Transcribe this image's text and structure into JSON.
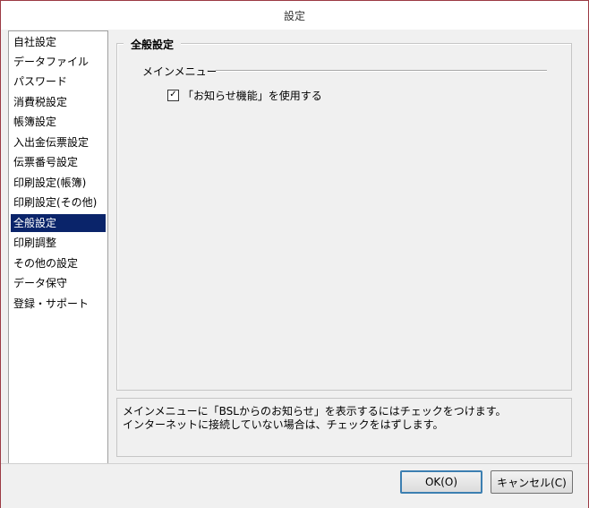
{
  "window": {
    "title": "設定"
  },
  "sidebar": {
    "items": [
      {
        "label": "自社設定",
        "selected": false
      },
      {
        "label": "データファイル",
        "selected": false
      },
      {
        "label": "パスワード",
        "selected": false
      },
      {
        "label": "消費税設定",
        "selected": false
      },
      {
        "label": "帳簿設定",
        "selected": false
      },
      {
        "label": "入出金伝票設定",
        "selected": false
      },
      {
        "label": "伝票番号設定",
        "selected": false
      },
      {
        "label": "印刷設定(帳簿)",
        "selected": false
      },
      {
        "label": "印刷設定(その他)",
        "selected": false
      },
      {
        "label": "全般設定",
        "selected": true
      },
      {
        "label": "印刷調整",
        "selected": false
      },
      {
        "label": "その他の設定",
        "selected": false
      },
      {
        "label": "データ保守",
        "selected": false
      },
      {
        "label": "登録・サポート",
        "selected": false
      }
    ]
  },
  "panel": {
    "title": "全般設定",
    "group_label": "メインメニュー",
    "checkbox": {
      "label": "「お知らせ機能」を使用する",
      "checked": true
    }
  },
  "description": {
    "lines": [
      "メインメニューに「BSLからのお知らせ」を表示するにはチェックをつけます。",
      "インターネットに接続していない場合は、チェックをはずします。"
    ]
  },
  "buttons": {
    "ok_label": "OK(O)",
    "cancel_label": "キャンセル(C)"
  },
  "colors": {
    "selection": "#0a246a",
    "window_border": "#9b3a44",
    "default_button_border": "#3c7fb1"
  }
}
